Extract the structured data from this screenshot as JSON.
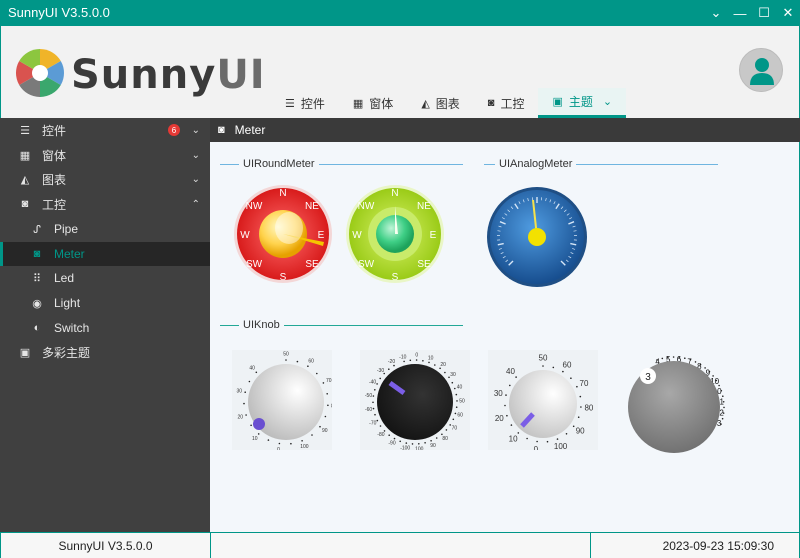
{
  "window": {
    "title": "SunnyUI V3.5.0.0",
    "controls": [
      "⌄",
      "—",
      "☐",
      "✕"
    ]
  },
  "header": {
    "logo_text_a": "Sunny",
    "logo_text_b": "UI",
    "tabs": [
      {
        "label": "控件",
        "icon": "grid-list-icon"
      },
      {
        "label": "窗体",
        "icon": "windows-icon"
      },
      {
        "label": "图表",
        "icon": "area-chart-icon"
      },
      {
        "label": "工控",
        "icon": "dashboard-gauge-icon"
      },
      {
        "label": "主题",
        "icon": "image-icon",
        "active": true
      }
    ]
  },
  "sidebar": {
    "items": [
      {
        "label": "控件",
        "badge": "6",
        "arrow": "⌄"
      },
      {
        "label": "窗体",
        "arrow": "⌄"
      },
      {
        "label": "图表",
        "arrow": "⌄"
      },
      {
        "label": "工控",
        "arrow": "⌃"
      },
      {
        "label": "Pipe"
      },
      {
        "label": "Meter",
        "active": true
      },
      {
        "label": "Led"
      },
      {
        "label": "Light"
      },
      {
        "label": "Switch"
      },
      {
        "label": "多彩主题"
      }
    ]
  },
  "page": {
    "title": "Meter",
    "groups": {
      "round": "UIRoundMeter",
      "analog": "UIAnalogMeter",
      "knob": "UIKnob"
    },
    "compass_labels": [
      "N",
      "NE",
      "E",
      "SE",
      "S",
      "SW",
      "W",
      "NW"
    ],
    "knob1_ticks": [
      "50",
      "60",
      "70",
      "80",
      "90",
      "100",
      "0",
      "10",
      "20",
      "30",
      "40"
    ],
    "knob2_ticks": [
      "-10",
      "0",
      "10",
      "20",
      "30",
      "40",
      "50",
      "60",
      "70",
      "80",
      "90",
      "100",
      "-100",
      "-90",
      "-80",
      "-70",
      "-60",
      "-50",
      "-40",
      "-30",
      "-20"
    ],
    "knob3_ticks": [
      "50",
      "60",
      "70",
      "80",
      "90",
      "100",
      "0",
      "10",
      "20",
      "30",
      "40"
    ],
    "knob4_ticks": [
      "4",
      "5",
      "6",
      "7",
      "8",
      "9",
      "10",
      "0",
      "1",
      "2",
      "3"
    ],
    "knob4_value": "3"
  },
  "footer": {
    "version": "SunnyUI V3.5.0.0",
    "datetime": "2023-09-23 15:09:30"
  },
  "colors": {
    "accent": "#009688",
    "sidebar": "#404040",
    "badge": "#e53935"
  }
}
